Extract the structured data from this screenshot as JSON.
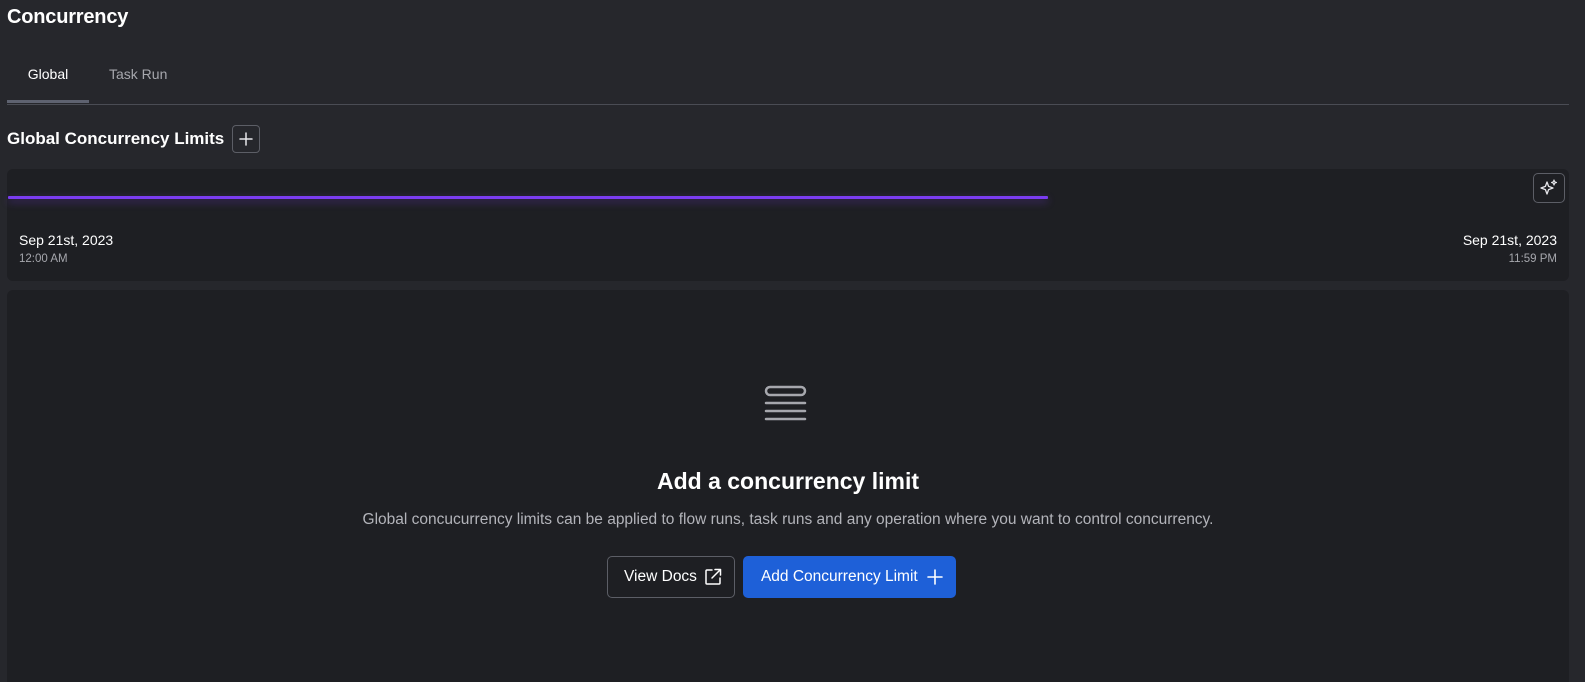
{
  "page": {
    "title": "Concurrency"
  },
  "tabs": [
    {
      "label": "Global",
      "active": true
    },
    {
      "label": "Task Run",
      "active": false
    }
  ],
  "section": {
    "title": "Global Concurrency Limits",
    "add_icon": "plus-icon"
  },
  "timeline": {
    "start_date": "Sep 21st, 2023",
    "start_time": "12:00 AM",
    "end_date": "Sep 21st, 2023",
    "end_time": "11:59 PM",
    "bar_color": "#7a3cf0",
    "magic_icon": "sparkles-icon"
  },
  "empty_state": {
    "icon": "stacked-lines-icon",
    "title": "Add a concurrency limit",
    "description": "Global concucurrency limits can be applied to flow runs, task runs and any operation where you want to control concurrency.",
    "docs_button": "View Docs",
    "docs_icon": "external-link-icon",
    "primary_button": "Add Concurrency Limit",
    "primary_icon": "plus-icon",
    "primary_color": "#1e60d8"
  }
}
